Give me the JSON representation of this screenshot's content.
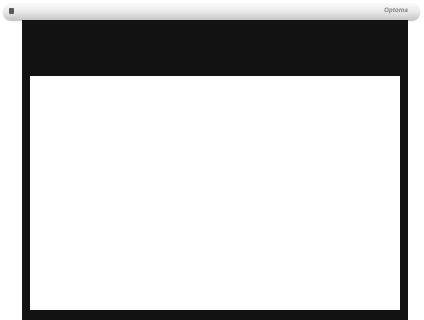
{
  "housing": {
    "brand_text": "Optoma"
  },
  "colors": {
    "housing": "#e8e8e8",
    "border": "#121212",
    "surface": "#ffffff"
  }
}
